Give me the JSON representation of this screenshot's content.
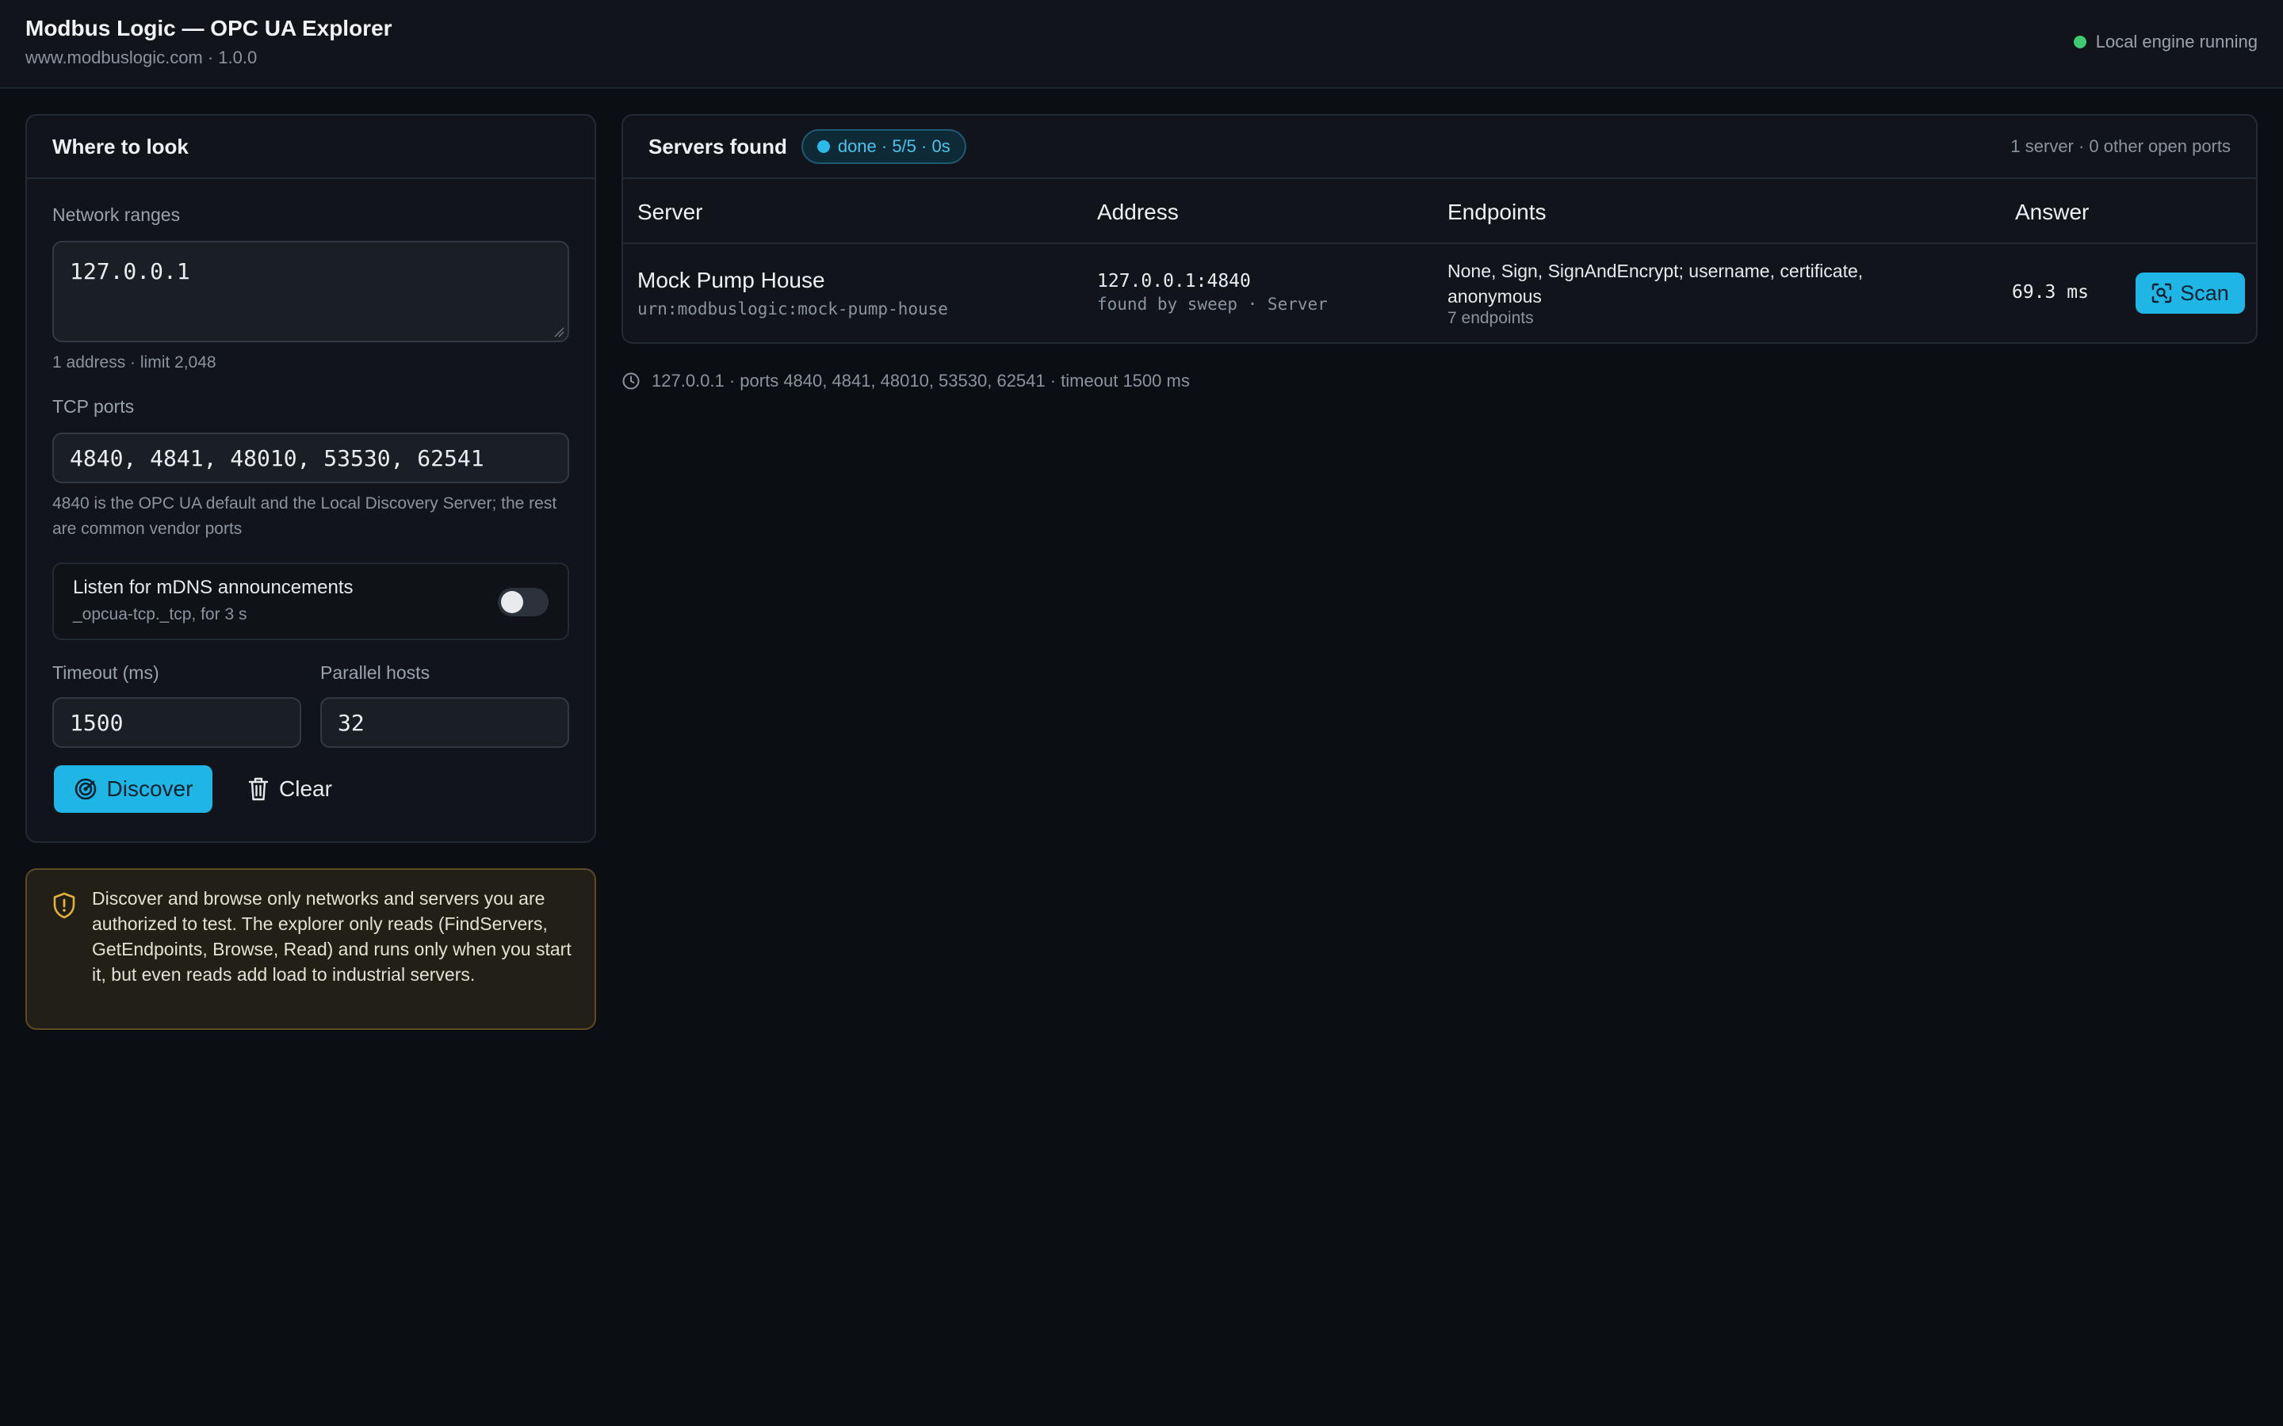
{
  "header": {
    "title": "Modbus Logic — OPC UA Explorer",
    "subtitle": "www.modbuslogic.com · 1.0.0",
    "engine_status": "Local engine running",
    "status_color": "#3ecb6f"
  },
  "search": {
    "title": "Where to look",
    "network_label": "Network ranges",
    "network_value": "127.0.0.1",
    "network_hint": "1 address · limit 2,048",
    "ports_label": "TCP ports",
    "ports_value": "4840, 4841, 48010, 53530, 62541",
    "ports_hint": "4840 is the OPC UA default and the Local Discovery Server; the rest are common vendor ports",
    "mdns_title": "Listen for mDNS announcements",
    "mdns_sub": "_opcua-tcp._tcp, for 3 s",
    "mdns_enabled": false,
    "timeout_label": "Timeout (ms)",
    "timeout_value": "1500",
    "parallel_label": "Parallel hosts",
    "parallel_value": "32",
    "discover_label": "Discover",
    "clear_label": "Clear"
  },
  "warning": {
    "text": "Discover and browse only networks and servers you are authorized to test. The explorer only reads (FindServers, GetEndpoints, Browse, Read) and runs only when you start it, but even reads add load to industrial servers."
  },
  "results": {
    "title": "Servers found",
    "badge": "done · 5/5 · 0s",
    "summary": "1 server · 0 other open ports",
    "columns": [
      "Server",
      "Address",
      "Endpoints",
      "Answer"
    ],
    "rows": [
      {
        "name": "Mock Pump House",
        "urn": "urn:modbuslogic:mock-pump-house",
        "address": "127.0.0.1:4840",
        "address_sub": "found by sweep · Server",
        "endpoints": "None, Sign, SignAndEncrypt; username, certificate, anonymous",
        "endpoint_count": "7 endpoints",
        "answer": "69.3 ms",
        "scan_label": "Scan"
      }
    ],
    "status_line": "127.0.0.1 · ports 4840, 4841, 48010, 53530, 62541 · timeout 1500 ms"
  },
  "colors": {
    "accent": "#1fb5e4",
    "warning_border": "#5e4a22",
    "warning_icon": "#e2b23c"
  }
}
